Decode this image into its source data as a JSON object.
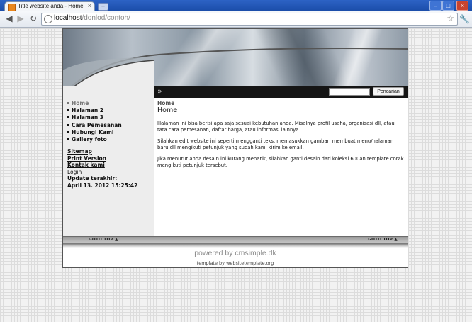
{
  "browser": {
    "tab_title": "Title website anda - Home",
    "tab_close": "×",
    "new_tab": "+",
    "window_buttons": {
      "minimize": "–",
      "maximize": "□",
      "close": "×"
    },
    "nav": {
      "back": "◀",
      "forward": "▶",
      "reload": "↻"
    },
    "url_host": "localhost",
    "url_path": "/donlod/contoh/",
    "bookmark": "☆",
    "menu": "🔧"
  },
  "site": {
    "nav_marker": "»",
    "search": {
      "placeholder": "",
      "button": "Pencarian"
    },
    "menu": [
      {
        "label": "Home",
        "active": true
      },
      {
        "label": "Halaman 2"
      },
      {
        "label": "Halaman 3"
      },
      {
        "label": "Cara Pemesanan"
      },
      {
        "label": "Hubungi Kami"
      },
      {
        "label": "Gallery foto"
      }
    ],
    "sidelinks": {
      "sitemap": "Sitemap",
      "print": "Print Version",
      "contact": "Kontak kami",
      "login": "Login",
      "updated_label": "Update terakhir:",
      "updated_date": "April 13. 2012 15:25:42"
    },
    "content": {
      "breadcrumb": "Home",
      "title": "Home",
      "paragraphs": [
        "Halaman ini bisa berisi apa saja sesuai kebutuhan anda. Misalnya profil usaha, organisasi dll, atau tata cara pemesanan, daftar harga, atau informasi lainnya.",
        "Silahkan edit website ini seperti mengganti teks, memasukkan gambar, membuat menu/halaman baru dll mengikuti petunjuk yang sudah kami kirim ke email.",
        "Jika menurut anda desain ini kurang menarik, silahkan ganti desain dari koleksi 600an template corak mengikuti petunjuk tersebut."
      ]
    },
    "footer": {
      "goto_left": "GOTO TOP ▲",
      "goto_right": "GOTO TOP ▲",
      "powered": "powered by cmsimple.dk",
      "template": "template by websitetemplate.org"
    }
  },
  "colors": {
    "page_bg": "#f2f2f2",
    "search_bar": "#151515",
    "sidebar": "#ededed"
  }
}
